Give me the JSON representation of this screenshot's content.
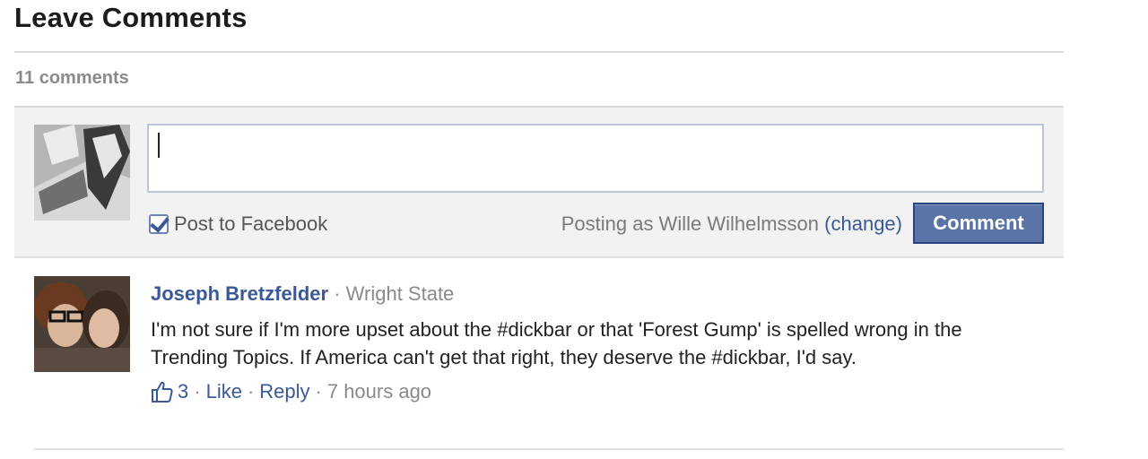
{
  "section": {
    "title": "Leave Comments",
    "count": "11 comments"
  },
  "composer": {
    "input_value": "",
    "post_to_facebook_label": "Post to Facebook",
    "post_to_facebook_checked": true,
    "posting_as_prefix": "Posting as Wille Wilhelmsson",
    "change_link": "(change)",
    "submit_label": "Comment"
  },
  "comments": [
    {
      "author": "Joseph Bretzfelder",
      "separator": "·",
      "affiliation": "Wright State",
      "text": "I'm not sure if I'm more upset about the #dickbar or that 'Forest Gump' is spelled wrong in the Trending Topics. If America can't get that right, they deserve the #dickbar, I'd say.",
      "like_count": "3",
      "like_label": "Like",
      "reply_label": "Reply",
      "time": "7 hours ago"
    }
  ],
  "colors": {
    "link": "#3b5998",
    "button": "#5b74a8",
    "muted": "#8a8a8a"
  },
  "icons": {
    "like": "thumbs-up-icon"
  }
}
